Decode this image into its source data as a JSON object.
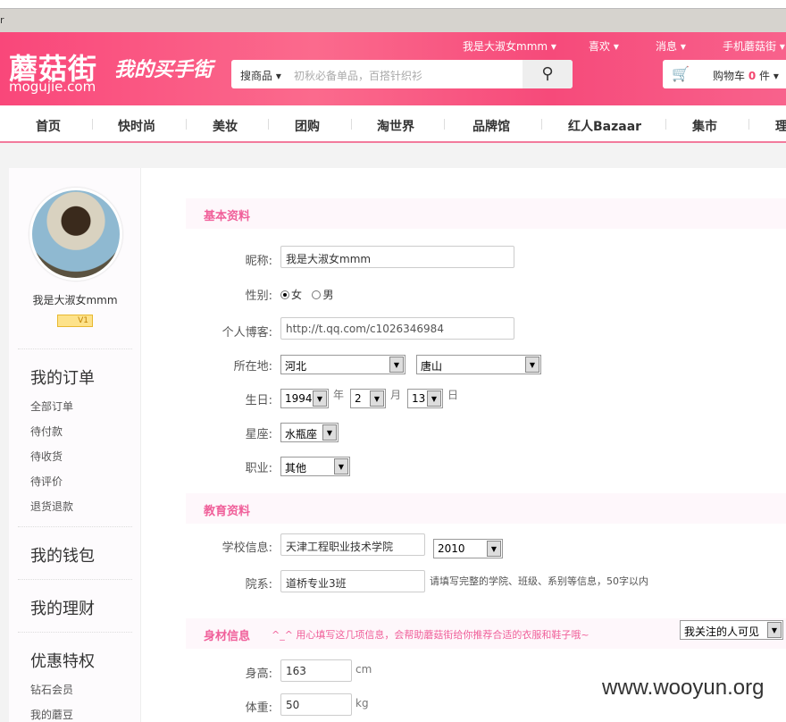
{
  "browser": {
    "title_fragment": "r"
  },
  "header": {
    "logo": "蘑菇街",
    "logo_sub": "mogujie.com",
    "slogan": "我的买手街",
    "top_links": [
      "我是大淑女mmm ▾",
      "喜欢 ▾",
      "消息 ▾",
      "手机蘑菇街 ▾"
    ],
    "search": {
      "category": "搜商品 ▾",
      "placeholder": "初秋必备单品，百搭针织衫"
    },
    "cart": {
      "label": "购物车",
      "count": "0",
      "unit": "件 ▾"
    }
  },
  "nav": [
    "首页",
    "快时尚",
    "美妆",
    "团购",
    "淘世界",
    "品牌馆",
    "红人Bazaar",
    "集市",
    "理"
  ],
  "sidebar": {
    "username": "我是大淑女mmm",
    "level": "V1",
    "orders": {
      "title": "我的订单",
      "items": [
        "全部订单",
        "待付款",
        "待收货",
        "待评价",
        "退货退款"
      ]
    },
    "wallet": "我的钱包",
    "finance": "我的理财",
    "privileges": {
      "title": "优惠特权",
      "items": [
        "钻石会员",
        "我的蘑豆"
      ]
    }
  },
  "basic": {
    "title": "基本资料",
    "nickname_label": "昵称:",
    "nickname": "我是大淑女mmm",
    "gender_label": "性别:",
    "female": "女",
    "male": "男",
    "blog_label": "个人博客:",
    "blog": "http://t.qq.com/c1026346984",
    "location_label": "所在地:",
    "province": "河北",
    "city": "唐山",
    "birthday_label": "生日:",
    "year": "1994",
    "year_unit": "年",
    "month": "2",
    "month_unit": "月",
    "day": "13",
    "day_unit": "日",
    "zodiac_label": "星座:",
    "zodiac": "水瓶座",
    "job_label": "职业:",
    "job": "其他"
  },
  "education": {
    "title": "教育资料",
    "school_label": "学校信息:",
    "school": "天津工程职业技术学院",
    "year": "2010",
    "dept_label": "院系:",
    "dept": "道桥专业3班",
    "dept_hint": "请填写完整的学院、班级、系别等信息，50字以内"
  },
  "body": {
    "title": "身材信息",
    "hint": "^_^ 用心填写这几项信息，会帮助蘑菇街给你推荐合适的衣服和鞋子哦~",
    "visibility": "我关注的人可见",
    "height_label": "身高:",
    "height": "163",
    "height_unit": "cm",
    "weight_label": "体重:",
    "weight": "50",
    "weight_unit": "kg"
  },
  "watermark": "www.wooyun.org"
}
